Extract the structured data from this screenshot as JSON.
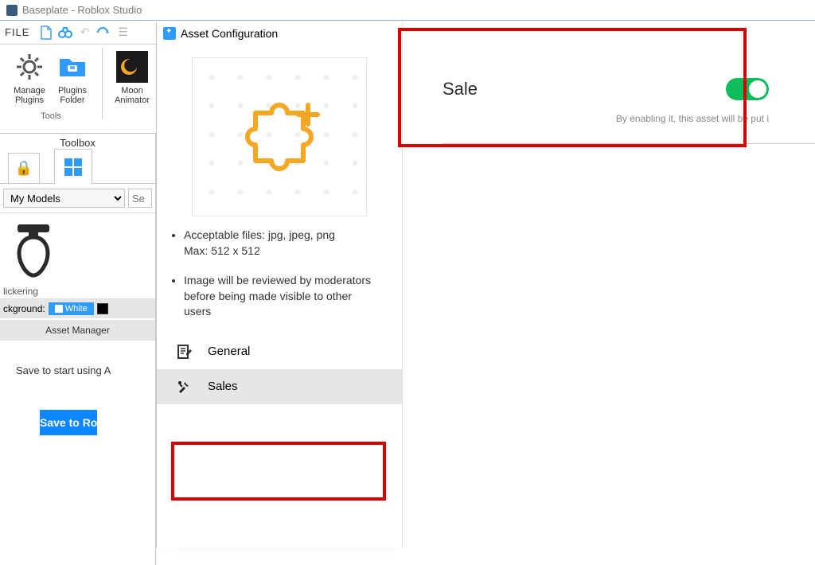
{
  "titlebar": {
    "text": "Baseplate - Roblox Studio"
  },
  "filebar": {
    "label": "FILE"
  },
  "ribbon": {
    "manage_plugins": "Manage Plugins",
    "plugins_folder": "Plugins Folder",
    "moon_animator": "Moon Animator",
    "group_label": "Tools"
  },
  "toolbox": {
    "title": "Toolbox",
    "dropdown_value": "My Models",
    "search_placeholder": "Se",
    "item_name": "lickering",
    "background_label": "ckground:",
    "white_chip": "White",
    "asset_manager": "Asset Manager",
    "save_msg": "Save to start using A",
    "save_btn": "Save to Ro"
  },
  "asset_config": {
    "title": "Asset Configuration",
    "note1_line1": "Acceptable files: jpg, jpeg, png",
    "note1_line2": "Max: 512 x 512",
    "note2": "Image will be reviewed by moderators before being made visible to other users",
    "nav_general": "General",
    "nav_sales": "Sales"
  },
  "sale": {
    "label": "Sale",
    "subtext": "By enabling it, this asset will be put i",
    "toggle_on": true
  }
}
